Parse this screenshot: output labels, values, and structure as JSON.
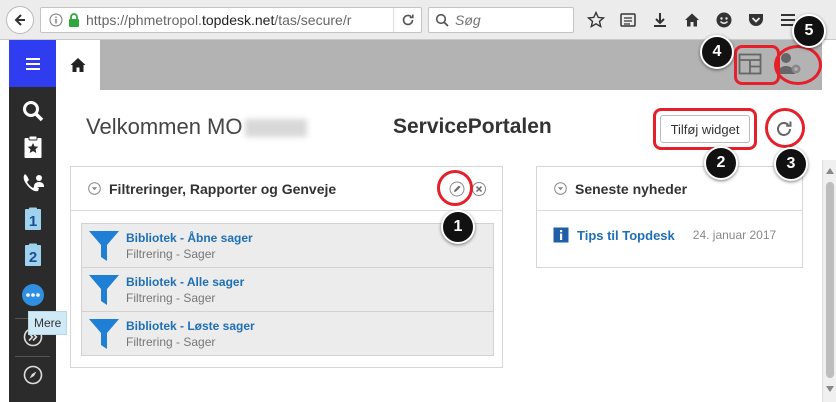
{
  "browser": {
    "url_prefix": "https://phmetropol.",
    "url_domain": "topdesk.net",
    "url_path": "/tas/secure/r",
    "search_placeholder": "Søg"
  },
  "sidebar": {
    "items": [
      {
        "icon": "hamburger-icon"
      },
      {
        "icon": "search-icon"
      },
      {
        "icon": "clipboard-star-icon"
      },
      {
        "icon": "phone-person-icon"
      },
      {
        "icon": "ticket-1-icon",
        "label": "1"
      },
      {
        "icon": "ticket-2-icon",
        "label": "2"
      },
      {
        "icon": "more-icon"
      },
      {
        "icon": "expand-icon"
      },
      {
        "icon": "compass-icon"
      }
    ],
    "more_tooltip": "Mere"
  },
  "header": {
    "welcome": "Velkommen MO",
    "portal_title": "ServicePortalen",
    "add_widget_label": "Tilføj widget"
  },
  "widgets": {
    "filters": {
      "title": "Filtreringer, Rapporter og Genveje",
      "items": [
        {
          "title": "Bibliotek - Åbne sager",
          "subtitle": "Filtrering - Sager"
        },
        {
          "title": "Bibliotek - Alle sager",
          "subtitle": "Filtrering - Sager"
        },
        {
          "title": "Bibliotek - Løste sager",
          "subtitle": "Filtrering - Sager"
        }
      ]
    },
    "news": {
      "title": "Seneste nyheder",
      "items": [
        {
          "title": "Tips til Topdesk",
          "date": "24. januar 2017"
        }
      ]
    }
  },
  "callouts": [
    "1",
    "2",
    "3",
    "4",
    "5"
  ],
  "colors": {
    "accent_blue": "#2f3cf0",
    "link_blue": "#1f6fb5",
    "callout_red": "#e5202b",
    "sidebar_dark": "#2b2b2b",
    "tab_band_gray": "#b3b3b3"
  }
}
